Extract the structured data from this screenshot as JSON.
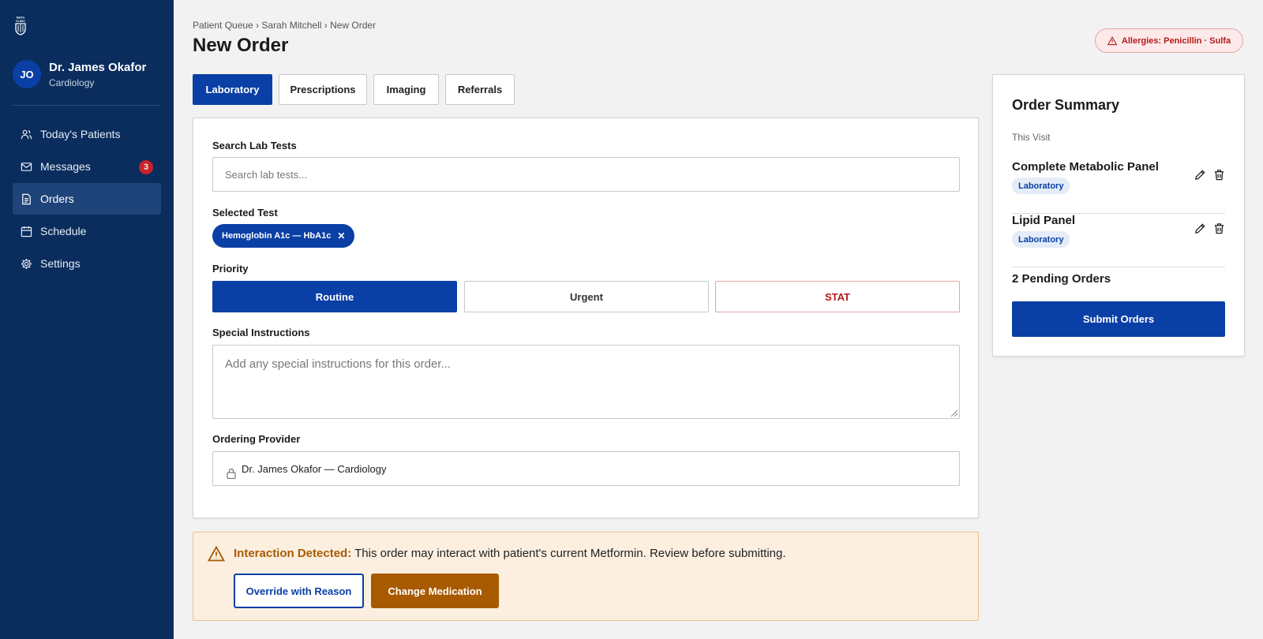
{
  "sidebar": {
    "logo_icon": "mayo-clinic-shield-icon",
    "logo_text": "MAYO CLINIC",
    "avatar_initials": "JO",
    "user_name": "Dr. James Okafor",
    "user_department": "Cardiology",
    "nav": [
      {
        "label": "Today's Patients",
        "icon": "users-icon"
      },
      {
        "label": "Messages",
        "icon": "mail-icon",
        "badge": "3"
      },
      {
        "label": "Orders",
        "icon": "document-icon",
        "active": true
      },
      {
        "label": "Schedule",
        "icon": "calendar-icon"
      },
      {
        "label": "Settings",
        "icon": "gear-icon"
      }
    ]
  },
  "header": {
    "breadcrumb": "Patient Queue › Sarah Mitchell › New Order",
    "title": "New Order",
    "allergy_label": "Allergies: Penicillin · Sulfa"
  },
  "tabs": [
    {
      "label": "Laboratory",
      "active": true
    },
    {
      "label": "Prescriptions"
    },
    {
      "label": "Imaging"
    },
    {
      "label": "Referrals"
    }
  ],
  "form": {
    "search_label": "Search Lab Tests",
    "search_placeholder": "Search lab tests...",
    "selected_label": "Selected Test",
    "selected_test": "Hemoglobin A1c — HbA1c",
    "priority_label": "Priority",
    "priorities": [
      "Routine",
      "Urgent",
      "STAT"
    ],
    "priority_selected": "Routine",
    "instructions_label": "Special Instructions",
    "instructions_placeholder": "Add any special instructions for this order...",
    "provider_label": "Ordering Provider",
    "provider_value": "Dr. James Okafor — Cardiology"
  },
  "interaction": {
    "title": "Interaction Detected:",
    "message": "This order may interact with patient's current Metformin. Review before submitting.",
    "override_label": "Override with Reason",
    "change_label": "Change Medication"
  },
  "summary": {
    "title": "Order Summary",
    "subtitle": "This Visit",
    "items": [
      {
        "name": "Complete Metabolic Panel",
        "category": "Laboratory"
      },
      {
        "name": "Lipid Panel",
        "category": "Laboratory"
      }
    ],
    "pending": "2 Pending Orders",
    "submit_label": "Submit Orders"
  },
  "colors": {
    "sidebar_bg": "#0a2d5e",
    "primary": "#0a3fa5",
    "danger": "#b01c1c",
    "warning": "#a85a00",
    "warning_bg": "#fcefe0"
  }
}
